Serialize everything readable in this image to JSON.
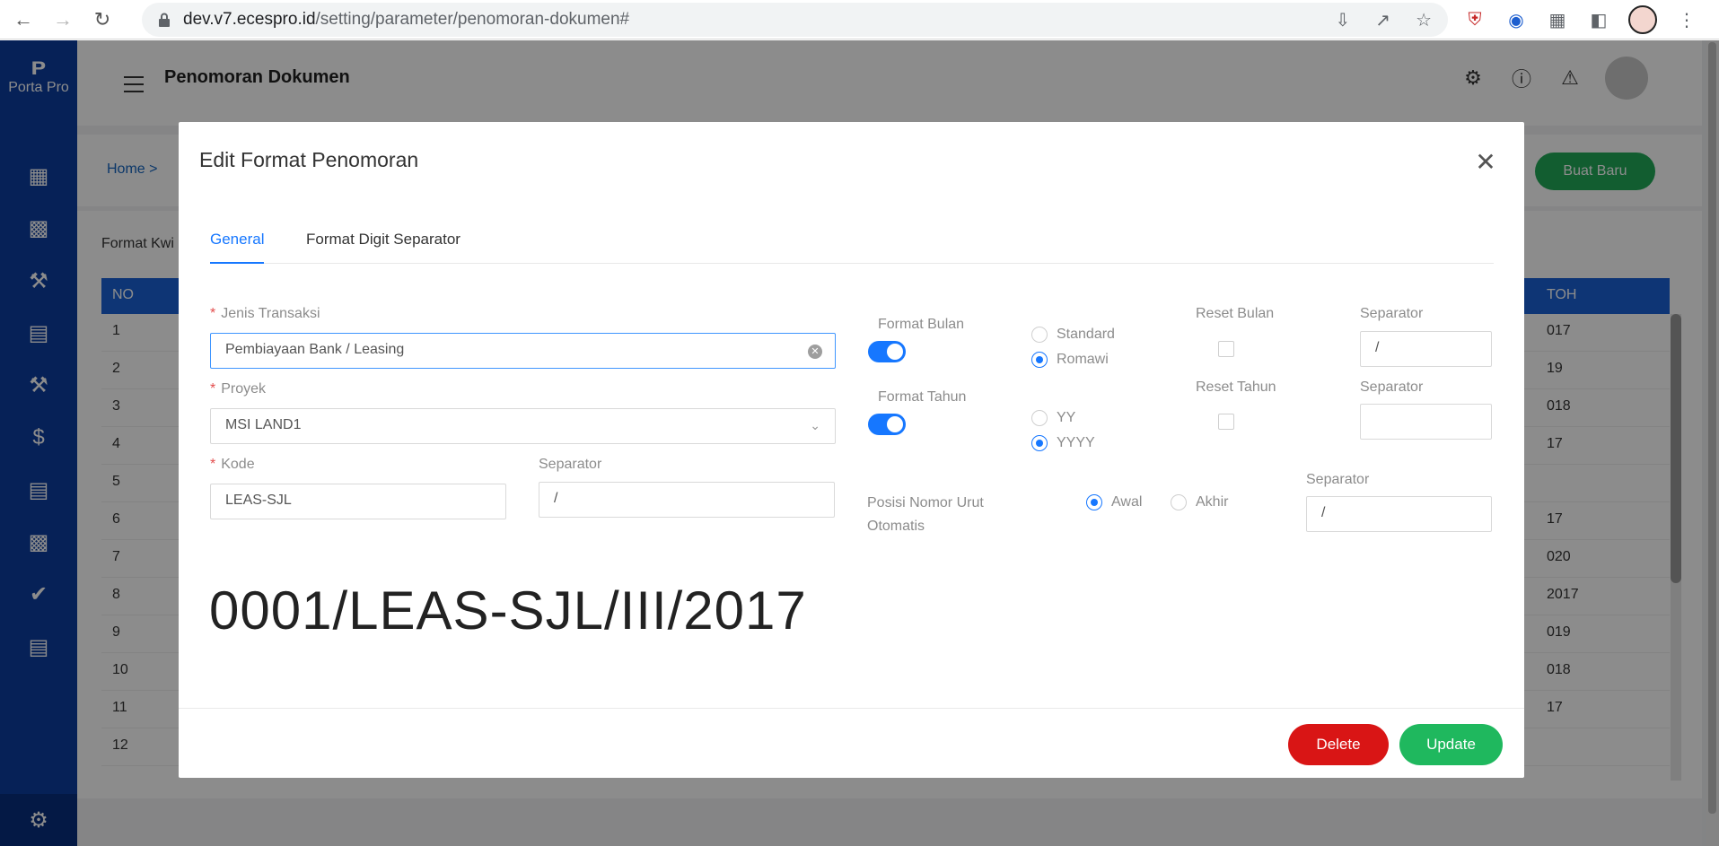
{
  "browser": {
    "url_host": "dev.v7.ecespro.id",
    "url_path": "/setting/parameter/penomoran-dokumen#"
  },
  "app": {
    "logo_text": "Porta Pro",
    "page_title": "Penomoran Dokumen",
    "breadcrumb": "Home  >",
    "new_button": "Buat Baru",
    "section_label": "Format Kwi",
    "table_header_no": "NO",
    "table_header_contoh": "TOH",
    "rows": [
      {
        "no": "1",
        "contoh": "017"
      },
      {
        "no": "2",
        "contoh": "19"
      },
      {
        "no": "3",
        "contoh": "018"
      },
      {
        "no": "4",
        "contoh": "17"
      },
      {
        "no": "5",
        "contoh": ""
      },
      {
        "no": "6",
        "contoh": "17"
      },
      {
        "no": "7",
        "contoh": "020"
      },
      {
        "no": "8",
        "contoh": "2017"
      },
      {
        "no": "9",
        "contoh": "019"
      },
      {
        "no": "10",
        "contoh": "018"
      },
      {
        "no": "11",
        "contoh": "17"
      },
      {
        "no": "12",
        "contoh": ""
      }
    ]
  },
  "modal": {
    "title": "Edit Format Penomoran",
    "tabs": [
      "General",
      "Format Digit Separator"
    ],
    "jenis_transaksi": {
      "label": "Jenis Transaksi",
      "value": "Pembiayaan Bank / Leasing"
    },
    "proyek": {
      "label": "Proyek",
      "value": "MSI LAND1"
    },
    "kode": {
      "label": "Kode",
      "value": "LEAS-SJL"
    },
    "kode_separator": {
      "label": "Separator",
      "value": "/"
    },
    "format_bulan": {
      "label": "Format Bulan",
      "enabled": true,
      "options": [
        "Standard",
        "Romawi"
      ],
      "selected": "Romawi"
    },
    "reset_bulan": {
      "label": "Reset Bulan",
      "checked": false
    },
    "bulan_separator": {
      "label": "Separator",
      "value": "/"
    },
    "format_tahun": {
      "label": "Format Tahun",
      "enabled": true,
      "options": [
        "YY",
        "YYYY"
      ],
      "selected": "YYYY"
    },
    "reset_tahun": {
      "label": "Reset Tahun",
      "checked": false
    },
    "tahun_separator": {
      "label": "Separator",
      "value": ""
    },
    "posisi": {
      "label_line1": "Posisi Nomor Urut",
      "label_line2": "Otomatis",
      "options": [
        "Awal",
        "Akhir"
      ],
      "selected": "Awal"
    },
    "posisi_separator": {
      "label": "Separator",
      "value": "/"
    },
    "preview": "0001/LEAS-SJL/III/2017",
    "delete_label": "Delete",
    "update_label": "Update"
  },
  "colors": {
    "sidebar": "#0c3c9f",
    "primary": "#1677ff",
    "delete": "#d91515",
    "update": "#1fb85e",
    "new_button": "#22a958"
  }
}
